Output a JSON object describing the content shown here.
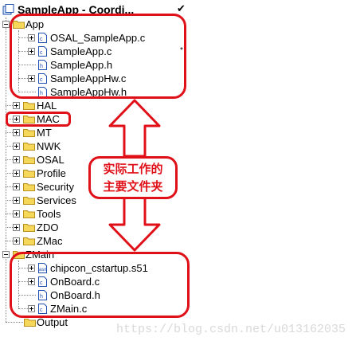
{
  "workspace": {
    "title": "SampleApp - Coordi...",
    "check": "✔"
  },
  "tree": {
    "app": {
      "label": "App",
      "children": [
        {
          "label": "OSAL_SampleApp.c",
          "expandable": true
        },
        {
          "label": "SampleApp.c",
          "expandable": true
        },
        {
          "label": "SampleApp.h",
          "expandable": false
        },
        {
          "label": "SampleAppHw.c",
          "expandable": true
        },
        {
          "label": "SampleAppHw.h",
          "expandable": false
        }
      ]
    },
    "folders": [
      "HAL",
      "MAC",
      "MT",
      "NWK",
      "OSAL",
      "Profile",
      "Security",
      "Services",
      "Tools",
      "ZDO",
      "ZMac"
    ],
    "zmain": {
      "label": "ZMain",
      "children": [
        {
          "label": "chipcon_cstartup.s51",
          "expandable": true,
          "type": "asm"
        },
        {
          "label": "OnBoard.c",
          "expandable": true,
          "type": "c"
        },
        {
          "label": "OnBoard.h",
          "expandable": false,
          "type": "c"
        },
        {
          "label": "ZMain.c",
          "expandable": true,
          "type": "c"
        }
      ]
    },
    "output": "Output"
  },
  "annotation": {
    "line1": "实际工作的",
    "line2": "主要文件夹"
  },
  "watermark": "https://blog.csdn.net/u013162035",
  "colors": {
    "highlight": "#e01018",
    "folder": "#f5d75a",
    "folder_edge": "#b98f1c",
    "file_icon": "#1f4fb0"
  }
}
